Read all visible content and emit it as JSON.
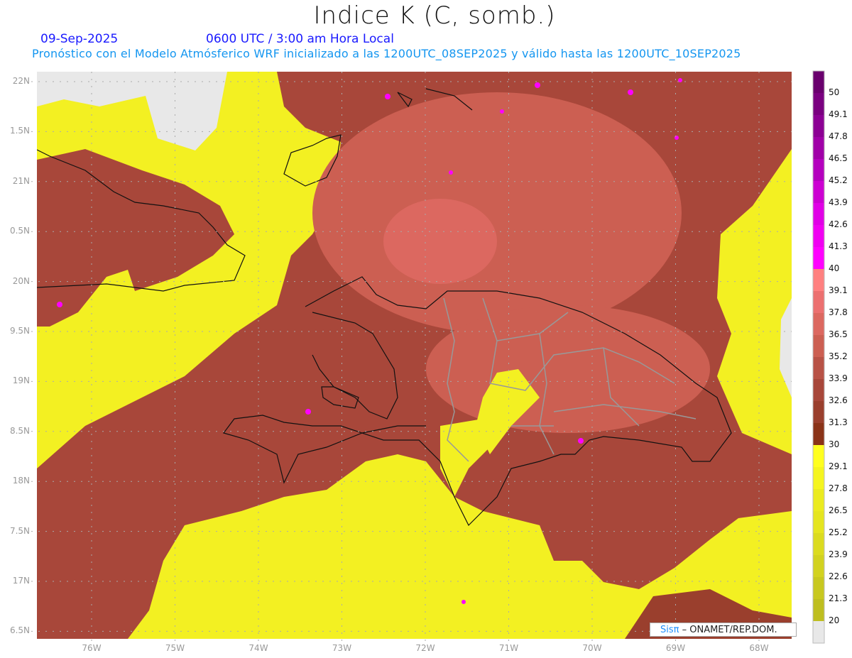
{
  "header": {
    "title": "Indice K (C, somb.)",
    "date": "09-Sep-2025",
    "time": "0600 UTC / 3:00 am Hora Local",
    "description": "Pronóstico con el Modelo Atmósferico WRF inicializado a las 1200UTC_08SEP2025 y válido hasta las  1200UTC_10SEP2025"
  },
  "axes": {
    "lat_labels": [
      "22N",
      "1.5N",
      "21N",
      "0.5N",
      "20N",
      "9.5N",
      "19N",
      "8.5N",
      "18N",
      "7.5N",
      "17N",
      "6.5N"
    ],
    "lon_labels": [
      "76W",
      "75W",
      "74W",
      "73W",
      "72W",
      "71W",
      "70W",
      "69W",
      "68W"
    ]
  },
  "legend": {
    "labels": [
      "50",
      "49.1",
      "47.8",
      "46.5",
      "45.2",
      "43.9",
      "42.6",
      "41.3",
      "40",
      "39.1",
      "37.8",
      "36.5",
      "35.2",
      "33.9",
      "32.6",
      "31.3",
      "30",
      "29.1",
      "27.8",
      "26.5",
      "25.2",
      "23.9",
      "22.6",
      "21.3",
      "20"
    ],
    "colors": [
      "#6a006e",
      "#7a0080",
      "#8c0094",
      "#a000a8",
      "#b400be",
      "#cc00d2",
      "#e000e6",
      "#f000f2",
      "#ff00ff",
      "#ff8080",
      "#ec7070",
      "#dc6860",
      "#cc5f52",
      "#b85246",
      "#a8473a",
      "#9a3f2d",
      "#8a3318",
      "#ffff20",
      "#f5f520",
      "#ebeb20",
      "#e5e520",
      "#dbdb20",
      "#d2d220",
      "#c8c820",
      "#bebe20",
      "#e8e8e8"
    ]
  },
  "credit": {
    "brand": "Sisπ",
    "org": "– ONAMET/REP.DOM."
  }
}
